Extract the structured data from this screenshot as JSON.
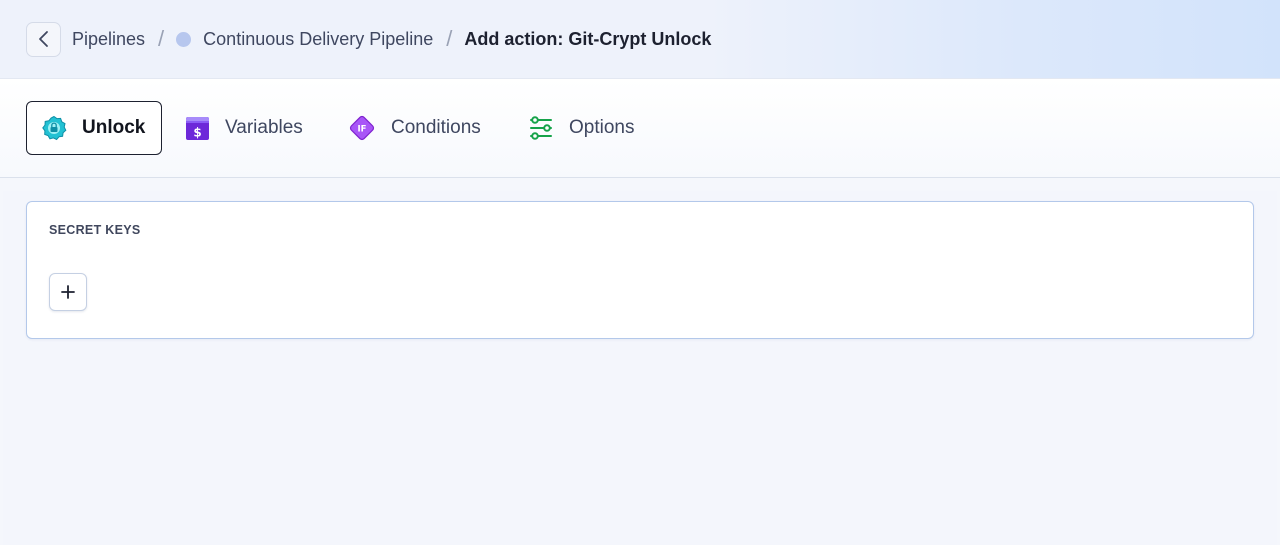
{
  "breadcrumb": {
    "items": [
      "Pipelines",
      "Continuous Delivery Pipeline"
    ],
    "separator": "/",
    "current": "Add action: Git-Crypt Unlock",
    "back_icon": "chevron-left-icon",
    "pipeline_status_color": "#b7c7ee"
  },
  "tabs": [
    {
      "label": "Unlock",
      "icon": "lock-badge-icon",
      "active": true
    },
    {
      "label": "Variables",
      "icon": "dollar-variable-icon",
      "active": false
    },
    {
      "label": "Conditions",
      "icon": "if-diamond-icon",
      "active": false
    },
    {
      "label": "Options",
      "icon": "sliders-icon",
      "active": false
    }
  ],
  "secret_keys": {
    "title": "SECRET KEYS",
    "add_icon": "plus-icon"
  },
  "colors": {
    "accent": "#b3c8ea",
    "variables_icon": "#7c3aed",
    "conditions_icon": "#a855f7",
    "options_icon": "#16a34a",
    "unlock_icon": "#22c1d3"
  }
}
